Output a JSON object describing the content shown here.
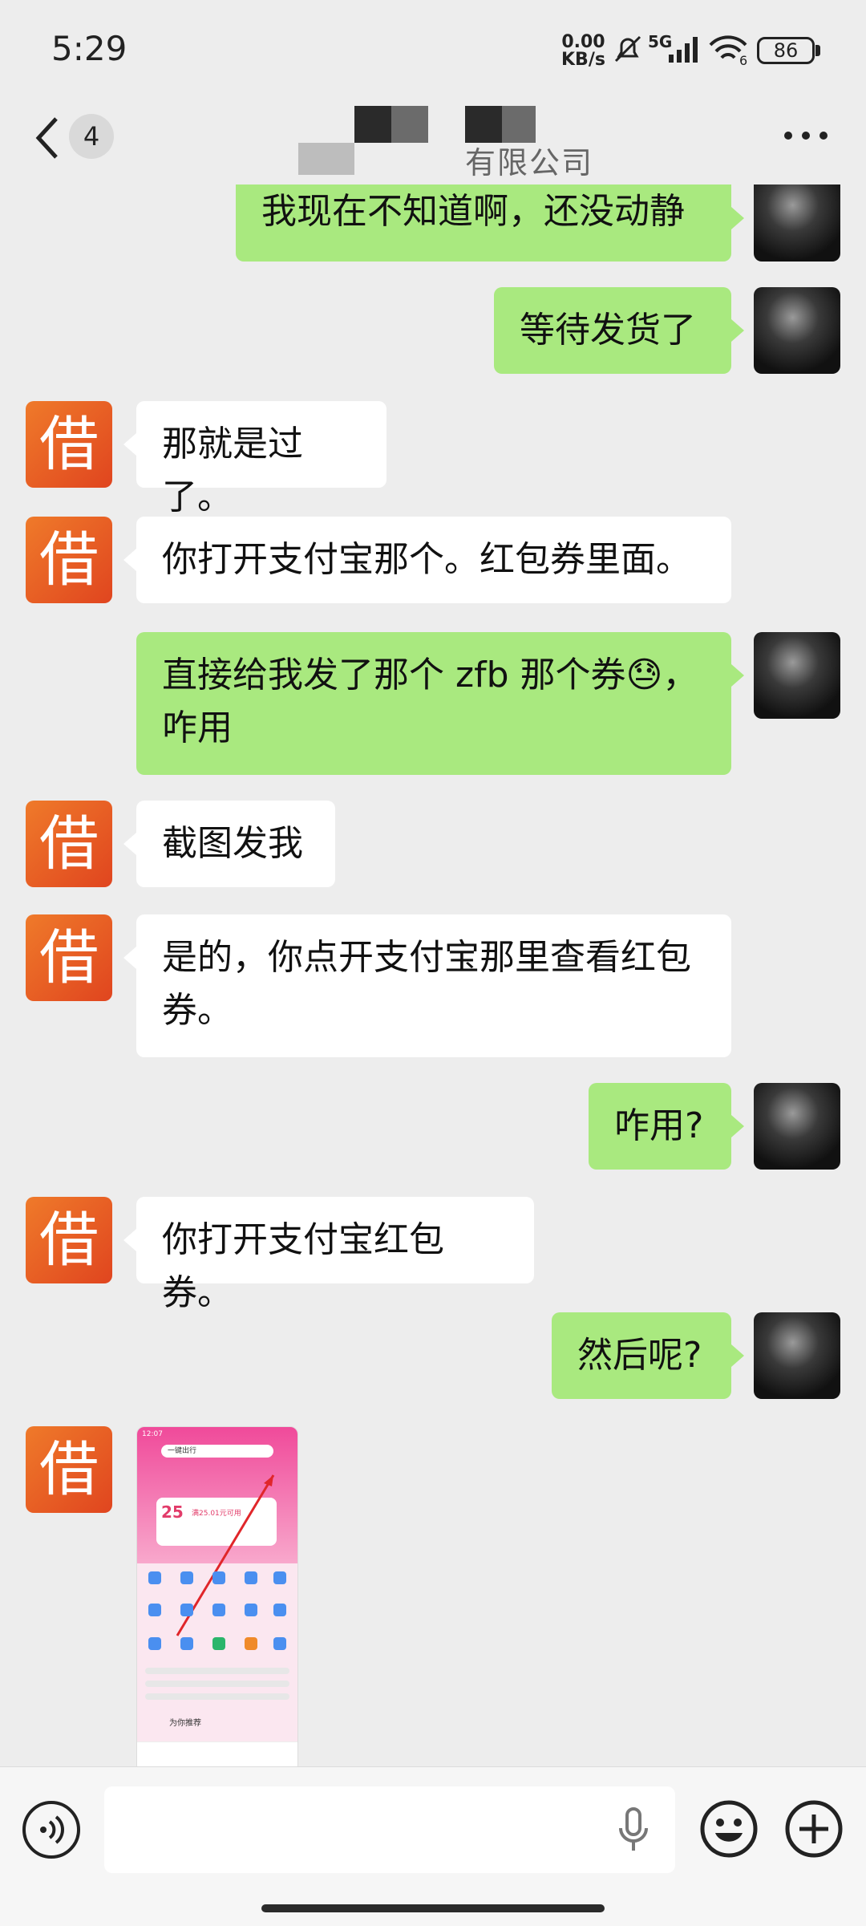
{
  "status": {
    "time": "5:29",
    "net_speed": "0.00",
    "net_unit": "KB/s",
    "signal_label": "5G",
    "wifi_label": "6",
    "battery": "86"
  },
  "header": {
    "unread_count": "4",
    "title_visible_fragment": "有限公司"
  },
  "messages": [
    {
      "side": "right",
      "text": "我现在不知道啊，还没动静"
    },
    {
      "side": "right",
      "text": "等待发货了"
    },
    {
      "side": "left",
      "text": "那就是过了。"
    },
    {
      "side": "left",
      "text": "你打开支付宝那个。红包券里面。"
    },
    {
      "side": "right",
      "text": "直接给我发了那个 zfb 那个券😓，咋用"
    },
    {
      "side": "left",
      "text": "截图发我"
    },
    {
      "side": "left",
      "text": "是的，你点开支付宝那里查看红包券。"
    },
    {
      "side": "right",
      "text": "咋用?"
    },
    {
      "side": "left",
      "text": "你打开支付宝红包券。"
    },
    {
      "side": "right",
      "text": "然后呢?"
    }
  ],
  "screenshot_preview": {
    "time": "12:07",
    "search_text": "一键出行",
    "coupon_amount": "25",
    "coupon_text": "满25.01元可用",
    "recommend_label": "为你推荐"
  },
  "bot_avatar_glyph": "借",
  "icons": {
    "back": "chevron-left-icon",
    "more": "more-dots-icon",
    "voice": "voice-icon",
    "mic": "mic-icon",
    "emoji": "emoji-icon",
    "plus": "plus-icon"
  },
  "colors": {
    "background": "#ededed",
    "bubble_self": "#a9e97f",
    "bubble_other": "#ffffff",
    "avatar_bot": "#e85a22"
  }
}
